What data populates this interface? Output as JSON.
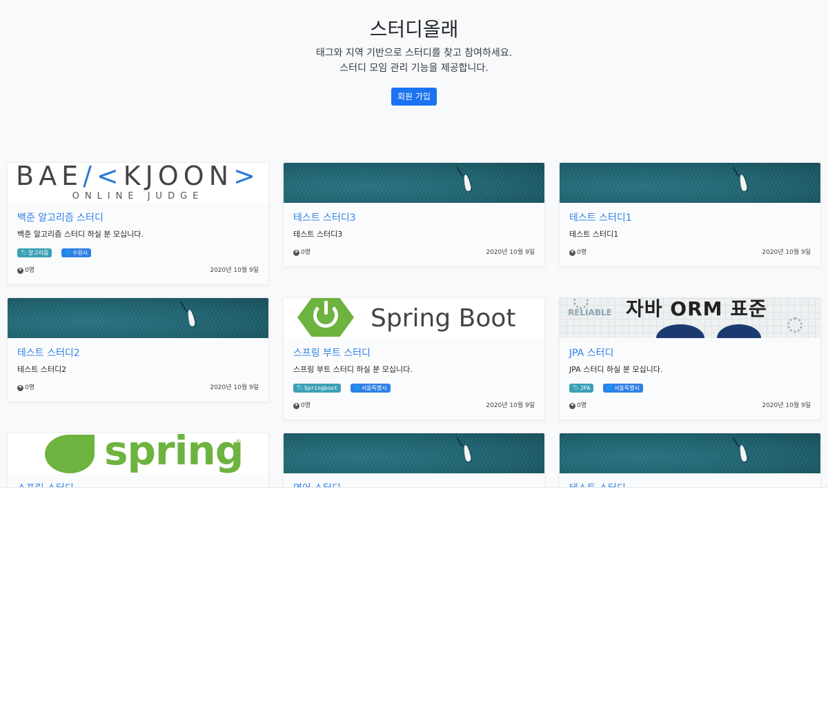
{
  "hero": {
    "title": "스터디올래",
    "line1": "태그와 지역 기반으로 스터디를 찾고 참여하세요.",
    "line2": "스터디 모임 관리 기능을 제공합니다.",
    "signup_label": "회원 가입"
  },
  "colors": {
    "primary": "#1a73f0",
    "link": "#2f80e6",
    "tag_topic": "#3ba0b6",
    "tag_zone": "#2f80e6",
    "page_bg": "#f8f9fa"
  },
  "icons": {
    "tag": "tag-icon",
    "zone": "globe-icon",
    "members": "user-circle-icon"
  },
  "cards": [
    {
      "title": "백준 알고리즘 스터디",
      "text": "백준 알고리즘 스터디 하실 분 모십니다.",
      "image": "baekjoon-logo",
      "logo_main_1": "BAE",
      "logo_main_2": "KJOON",
      "logo_sub": "ONLINE JUDGE",
      "tag": "알고리즘",
      "zone": "수원시",
      "members": "0명",
      "date": "2020년 10월 9일"
    },
    {
      "title": "테스트 스터디3",
      "text": "테스트 스터디3",
      "image": "default-sea",
      "members": "0명",
      "date": "2020년 10월 9일"
    },
    {
      "title": "테스트 스터디1",
      "text": "테스트 스터디1",
      "image": "default-sea",
      "members": "0명",
      "date": "2020년 10월 9일"
    },
    {
      "title": "테스트 스터디2",
      "text": "테스트 스터디2",
      "image": "default-sea",
      "members": "0명",
      "date": "2020년 10월 9일"
    },
    {
      "title": "스프링 부트 스터디",
      "text": "스프링 부트 스터디 하실 분 모십니다.",
      "image": "spring-boot-logo",
      "logo_text": "Spring Boot",
      "tag": "Springboot",
      "zone": "서울특별시",
      "members": "0명",
      "date": "2020년 10월 9일"
    },
    {
      "title": "JPA 스터디",
      "text": "JPA 스터디 하실 분 모십니다.",
      "image": "jpa-book-cover",
      "logo_text": "자바 ORM 표준",
      "logo_small": "RELIABLE",
      "tag": "JPA",
      "zone": "서울특별시",
      "members": "0명",
      "date": "2020년 10월 9일"
    },
    {
      "title": "스프링 스터디",
      "image": "spring-logo",
      "logo_text": "spring",
      "logo_reg": "®"
    },
    {
      "title": "영어 스터디",
      "image": "default-sea"
    },
    {
      "title": "테스트 스터디",
      "image": "default-sea"
    }
  ]
}
